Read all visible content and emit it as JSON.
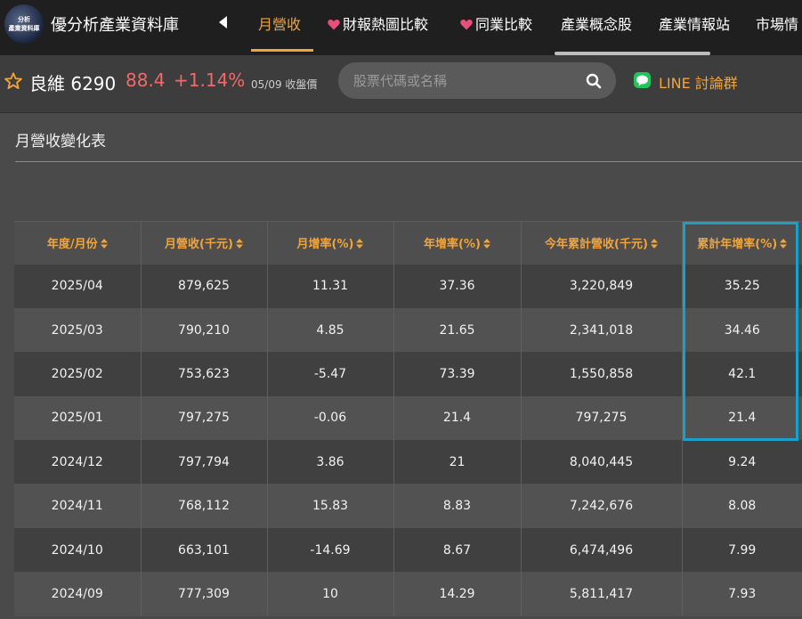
{
  "header": {
    "logo_lines": [
      "分析",
      "產業資料庫"
    ],
    "site_title": "優分析產業資料庫",
    "tabs": [
      {
        "label": "月營收",
        "active": true,
        "heart": false
      },
      {
        "label": "財報熱圖比較",
        "active": false,
        "heart": true
      },
      {
        "label": "同業比較",
        "active": false,
        "heart": true
      },
      {
        "label": "產業概念股",
        "active": false,
        "heart": false
      },
      {
        "label": "產業情報站",
        "active": false,
        "heart": false
      },
      {
        "label": "市場情",
        "active": false,
        "heart": false
      }
    ]
  },
  "stock": {
    "name": "良維 6290",
    "price": "88.4",
    "change": "+1.14%",
    "date": "05/09 收盤價",
    "search_placeholder": "股票代碼或名稱",
    "line_label": "LINE 討論群"
  },
  "section": {
    "title": "月營收變化表"
  },
  "table": {
    "columns": [
      "年度/月份",
      "月營收(千元)",
      "月增率(%)",
      "年增率(%)",
      "今年累計營收(千元)",
      "累計年增率(%)"
    ],
    "rows": [
      [
        "2025/04",
        "879,625",
        "11.31",
        "37.36",
        "3,220,849",
        "35.25"
      ],
      [
        "2025/03",
        "790,210",
        "4.85",
        "21.65",
        "2,341,018",
        "34.46"
      ],
      [
        "2025/02",
        "753,623",
        "-5.47",
        "73.39",
        "1,550,858",
        "42.1"
      ],
      [
        "2025/01",
        "797,275",
        "-0.06",
        "21.4",
        "797,275",
        "21.4"
      ],
      [
        "2024/12",
        "797,794",
        "3.86",
        "21",
        "8,040,445",
        "9.24"
      ],
      [
        "2024/11",
        "768,112",
        "15.83",
        "8.83",
        "7,242,676",
        "8.08"
      ],
      [
        "2024/10",
        "663,101",
        "-14.69",
        "8.67",
        "6,474,496",
        "7.99"
      ],
      [
        "2024/09",
        "777,309",
        "10",
        "14.29",
        "5,811,417",
        "7.93"
      ]
    ]
  },
  "colors": {
    "accent": "#f2a43a",
    "price_up": "#f06a6a",
    "highlight": "#1aa0c8",
    "line_green": "#22c35a"
  }
}
